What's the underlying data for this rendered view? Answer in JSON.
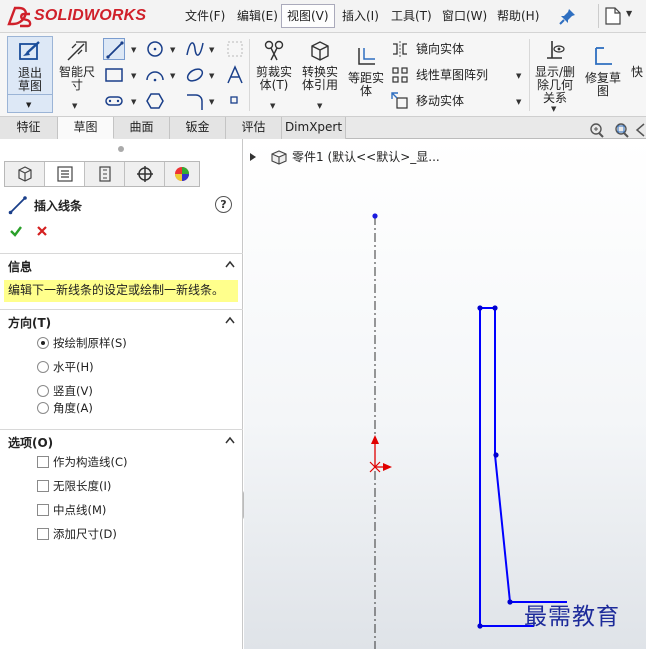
{
  "app": {
    "logo_text": "SOLIDWORKS"
  },
  "menu": {
    "items": [
      {
        "label": "文件(F)"
      },
      {
        "label": "编辑(E)"
      },
      {
        "label": "视图(V)"
      },
      {
        "label": "插入(I)"
      },
      {
        "label": "工具(T)"
      },
      {
        "label": "窗口(W)"
      },
      {
        "label": "帮助(H)"
      }
    ]
  },
  "ribbon": {
    "exit_sketch": "退出草图",
    "smart_dim": "智能尺寸",
    "trim": "剪裁实体(T)",
    "convert": "转换实体引用",
    "offset": "等距实体",
    "mirror": "镜向实体",
    "linear_pattern": "线性草图阵列",
    "move": "移动实体",
    "show_delete": "显示/删除几何关系",
    "repair": "修复草图",
    "quick": "快"
  },
  "tabs": [
    {
      "label": "特征"
    },
    {
      "label": "草图"
    },
    {
      "label": "曲面"
    },
    {
      "label": "钣金"
    },
    {
      "label": "评估"
    },
    {
      "label": "DimXpert"
    }
  ],
  "pm": {
    "title": "插入线条",
    "help": "?",
    "info_group": "信息",
    "info_msg": "编辑下一新线条的设定或绘制一新线条。",
    "direction_group": "方向(T)",
    "direction_options": [
      {
        "label": "按绘制原样(S)",
        "selected": true
      },
      {
        "label": "水平(H)",
        "selected": false
      },
      {
        "label": "竖直(V)",
        "selected": false
      },
      {
        "label": "角度(A)",
        "selected": false
      }
    ],
    "options_group": "选项(O)",
    "option_checks": [
      {
        "label": "作为构造线(C)",
        "checked": false
      },
      {
        "label": "无限长度(I)",
        "checked": false
      },
      {
        "label": "中点线(M)",
        "checked": false
      },
      {
        "label": "添加尺寸(D)",
        "checked": false
      }
    ]
  },
  "graphics": {
    "tree_flyout": "零件1  (默认<<默认>_显...",
    "watermark": "最需教育",
    "sketch_color": "#0000ff",
    "origin_color": "#e00000"
  },
  "colors": {
    "brand_red": "#d0202a",
    "info_yellow": "#ffff8c",
    "ok_green": "#2aa02a",
    "cancel_red": "#d42020"
  }
}
